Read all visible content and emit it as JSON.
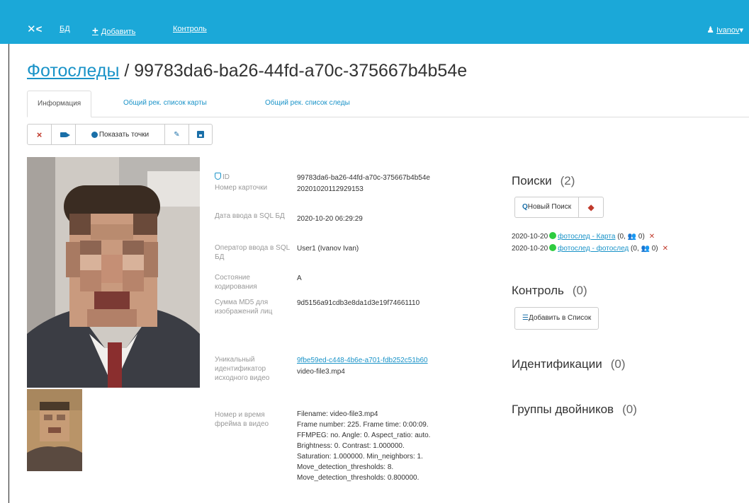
{
  "navbar": {
    "logo": "✕<",
    "db_label": "БД",
    "add_label": "Добавить",
    "add_icon": "+",
    "control_label": "Контроль",
    "user_icon": "user-icon",
    "user_label": "Ivanov"
  },
  "title": {
    "crumb": "Фотоследы",
    "separator": " / ",
    "id": "99783da6-ba26-44fd-a70c-375667b4b54e"
  },
  "tabs": [
    {
      "label": "Информация",
      "active": true
    },
    {
      "label": "Общий рек. список карты",
      "active": false
    },
    {
      "label": "Общий рек. список следы",
      "active": false
    }
  ],
  "toolbar": {
    "delete_icon": "×",
    "show_points_label": "Показать точки",
    "edit_icon": "✎"
  },
  "info": {
    "id_label": "ID",
    "id_value": "99783da6-ba26-44fd-a70c-375667b4b54e",
    "card_number_label": "Номер карточки",
    "card_number_value": "20201020112929153",
    "entry_date_label": "Дата ввода в SQL БД",
    "entry_date_value": "2020-10-20 06:29:29",
    "operator_label": "Оператор ввода в SQL БД",
    "operator_value": "User1 (Ivanov Ivan)",
    "coding_state_label": "Состояние кодирования",
    "coding_state_value": "A",
    "md5_label": "Сумма MD5 для изображений лиц",
    "md5_value": "9d5156a91cdb3e8da1d3e19f74661110",
    "video_uid_label": "Уникальный идентификатор исходного видео",
    "video_uid_value": "9fbe59ed-c448-4b6e-a701-fdb252c51b60",
    "video_file_value": "video-file3.mp4",
    "frame_label": "Номер и время фрейма в видео",
    "frame_lines": [
      "Filename: video-file3.mp4",
      "Frame number: 225. Frame time: 0:00:09.",
      "FFMPEG: no. Angle: 0. Aspect_ratio: auto.",
      "Brightness: 0. Contrast: 1.000000.",
      "Saturation: 1.000000. Min_neighbors: 1.",
      "Move_detection_thresholds: 8.",
      "Move_detection_thresholds: 0.800000."
    ]
  },
  "searches": {
    "title": "Поиски",
    "count": "(2)",
    "new_search_label": "Новый Поиск",
    "items": [
      {
        "date": "2020-10-20",
        "status_color": "#2ecc40",
        "link": "фотослед - Карта",
        "stats": "(0, 👥 0)"
      },
      {
        "date": "2020-10-20",
        "status_color": "#2ecc40",
        "link": "фотослед - фотослед",
        "stats": "(0, 👥 0)"
      }
    ]
  },
  "control": {
    "title": "Контроль",
    "count": "(0)",
    "add_to_list_label": "Добавить в Список"
  },
  "identifications": {
    "title": "Идентификации",
    "count": "(0)"
  },
  "twins": {
    "title": "Группы двойников",
    "count": "(0)"
  }
}
